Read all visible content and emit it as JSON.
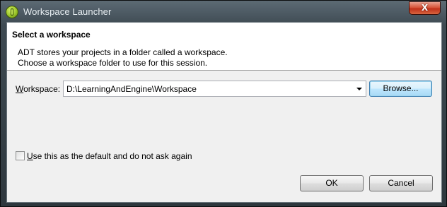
{
  "window": {
    "title": "Workspace Launcher",
    "close_label": "X",
    "app_icon": "adt-logo-icon"
  },
  "header": {
    "title": "Select a workspace",
    "description_line1": "ADT stores your projects in a folder called a workspace.",
    "description_line2": "Choose a workspace folder to use for this session."
  },
  "workspace": {
    "label_mnemonic": "W",
    "label_rest": "orkspace:",
    "value": "D:\\LearningAndEngine\\Workspace",
    "browse_label": "Browse..."
  },
  "default_checkbox": {
    "checked": false,
    "label_mnemonic": "U",
    "label_rest": "se this as the default and do not ask again"
  },
  "buttons": {
    "ok_label": "OK",
    "cancel_label": "Cancel"
  },
  "colors": {
    "close_button": "#c0301a",
    "client_background": "#f0f0f0",
    "header_background": "#ffffff"
  }
}
